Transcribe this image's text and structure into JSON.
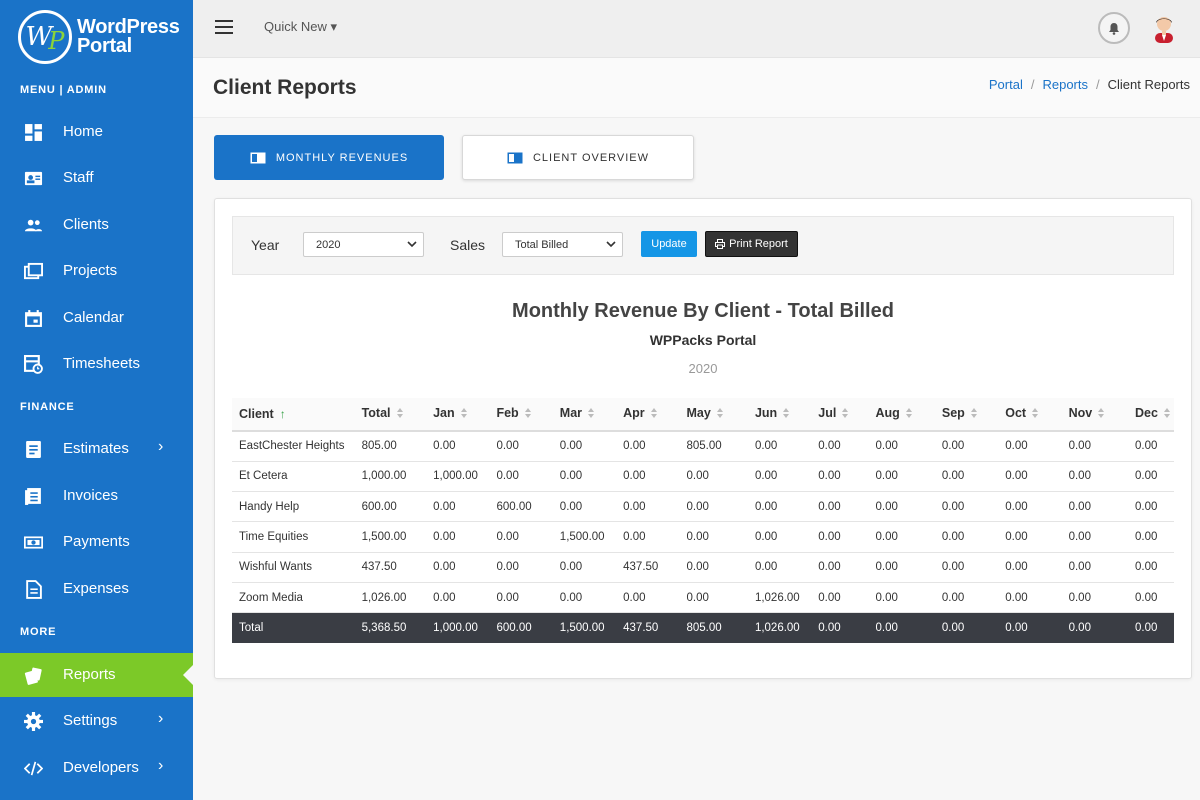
{
  "brand": {
    "line1": "WordPress",
    "line2": "Portal",
    "mark_w": "W",
    "mark_p": "P"
  },
  "sidebar": {
    "sections": [
      {
        "label": "MENU | ADMIN"
      },
      {
        "label": "FINANCE"
      },
      {
        "label": "MORE"
      }
    ],
    "items": [
      {
        "label": "Home",
        "icon": "home-icon"
      },
      {
        "label": "Staff",
        "icon": "id-card-icon"
      },
      {
        "label": "Clients",
        "icon": "users-icon"
      },
      {
        "label": "Projects",
        "icon": "projects-icon"
      },
      {
        "label": "Calendar",
        "icon": "calendar-icon"
      },
      {
        "label": "Timesheets",
        "icon": "timesheet-icon"
      },
      {
        "label": "Estimates",
        "icon": "estimate-icon",
        "chevron": "›"
      },
      {
        "label": "Invoices",
        "icon": "invoice-icon"
      },
      {
        "label": "Payments",
        "icon": "money-icon"
      },
      {
        "label": "Expenses",
        "icon": "document-icon"
      },
      {
        "label": "Reports",
        "icon": "reports-icon",
        "active": true
      },
      {
        "label": "Settings",
        "icon": "gear-icon",
        "chevron": "›"
      },
      {
        "label": "Developers",
        "icon": "code-icon",
        "chevron": "›"
      }
    ]
  },
  "topbar": {
    "quick_new": "Quick New ▾"
  },
  "page": {
    "title": "Client Reports",
    "breadcrumb": [
      "Portal",
      "Reports",
      "Client Reports"
    ]
  },
  "tabs": [
    {
      "label": "MONTHLY REVENUES",
      "active": true
    },
    {
      "label": "CLIENT OVERVIEW",
      "active": false
    }
  ],
  "filters": {
    "year_label": "Year",
    "year_value": "2020",
    "sales_label": "Sales",
    "sales_value": "Total Billed",
    "update_label": "Update",
    "print_label": "Print Report"
  },
  "report": {
    "title": "Monthly Revenue By Client - Total Billed",
    "subtitle": "WPPacks Portal",
    "year": "2020"
  },
  "table": {
    "headers": [
      "Client",
      "Total",
      "Jan",
      "Feb",
      "Mar",
      "Apr",
      "May",
      "Jun",
      "Jul",
      "Aug",
      "Sep",
      "Oct",
      "Nov",
      "Dec"
    ],
    "rows": [
      [
        "EastChester Heights",
        "805.00",
        "0.00",
        "0.00",
        "0.00",
        "0.00",
        "805.00",
        "0.00",
        "0.00",
        "0.00",
        "0.00",
        "0.00",
        "0.00",
        "0.00"
      ],
      [
        "Et Cetera",
        "1,000.00",
        "1,000.00",
        "0.00",
        "0.00",
        "0.00",
        "0.00",
        "0.00",
        "0.00",
        "0.00",
        "0.00",
        "0.00",
        "0.00",
        "0.00"
      ],
      [
        "Handy Help",
        "600.00",
        "0.00",
        "600.00",
        "0.00",
        "0.00",
        "0.00",
        "0.00",
        "0.00",
        "0.00",
        "0.00",
        "0.00",
        "0.00",
        "0.00"
      ],
      [
        "Time Equities",
        "1,500.00",
        "0.00",
        "0.00",
        "1,500.00",
        "0.00",
        "0.00",
        "0.00",
        "0.00",
        "0.00",
        "0.00",
        "0.00",
        "0.00",
        "0.00"
      ],
      [
        "Wishful Wants",
        "437.50",
        "0.00",
        "0.00",
        "0.00",
        "437.50",
        "0.00",
        "0.00",
        "0.00",
        "0.00",
        "0.00",
        "0.00",
        "0.00",
        "0.00"
      ],
      [
        "Zoom Media",
        "1,026.00",
        "0.00",
        "0.00",
        "0.00",
        "0.00",
        "0.00",
        "1,026.00",
        "0.00",
        "0.00",
        "0.00",
        "0.00",
        "0.00",
        "0.00"
      ]
    ],
    "total": [
      "Total",
      "5,368.50",
      "1,000.00",
      "600.00",
      "1,500.00",
      "437.50",
      "805.00",
      "1,026.00",
      "0.00",
      "0.00",
      "0.00",
      "0.00",
      "0.00",
      "0.00"
    ]
  },
  "colors": {
    "sidebar": "#1a73c8",
    "active_nav": "#7cc928",
    "update_btn": "#1596e6",
    "total_row": "#3a3d44"
  }
}
